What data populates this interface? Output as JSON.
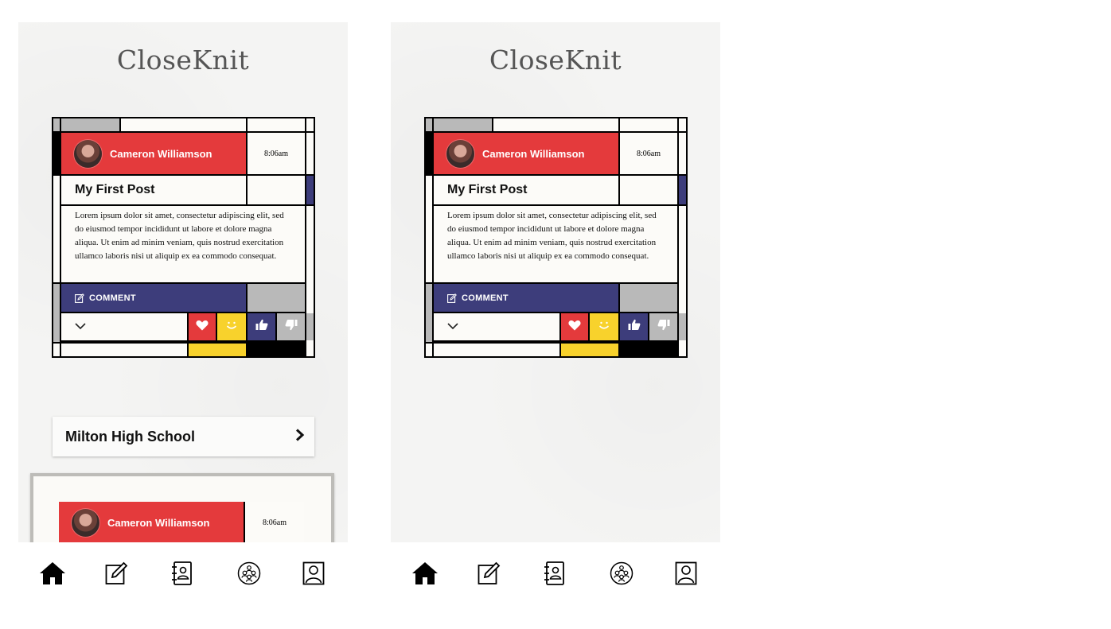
{
  "app": {
    "title": "CloseKnit"
  },
  "colors": {
    "red": "#e43a3c",
    "blue": "#3d3d7b",
    "yellow": "#f8d22c",
    "gray": "#b9b9b9",
    "black": "#000000",
    "paper": "#f4f4f3"
  },
  "left_screen": {
    "post": {
      "author": "Cameron Williamson",
      "time": "8:06am",
      "title": "My First Post",
      "body": "Lorem ipsum dolor sit amet, consectetur adipiscing elit, sed do eiusmod tempor incididunt ut labore et dolore magna aliqua. Ut enim ad minim veniam, quis nostrud exercitation ullamco laboris nisi ut aliquip ex ea commodo consequat.",
      "comment_label": "COMMENT"
    },
    "group": {
      "name": "Milton High School"
    },
    "preview_post": {
      "author": "Cameron Williamson",
      "time": "8:06am"
    }
  },
  "right_screen": {
    "post": {
      "author": "Cameron Williamson",
      "time": "8:06am",
      "title": "My First Post",
      "body": "Lorem ipsum dolor sit amet, consectetur adipiscing elit, sed do eiusmod tempor incididunt ut labore et dolore magna aliqua. Ut enim ad minim veniam, quis nostrud exercitation ullamco laboris nisi ut aliquip ex ea commodo consequat.",
      "comment_label": "COMMENT"
    }
  },
  "reactions": [
    "heart-icon",
    "smile-icon",
    "thumbs-up-icon",
    "thumbs-down-icon"
  ],
  "nav": {
    "items": [
      "home-icon",
      "compose-icon",
      "contacts-icon",
      "groups-icon",
      "profile-icon"
    ]
  }
}
